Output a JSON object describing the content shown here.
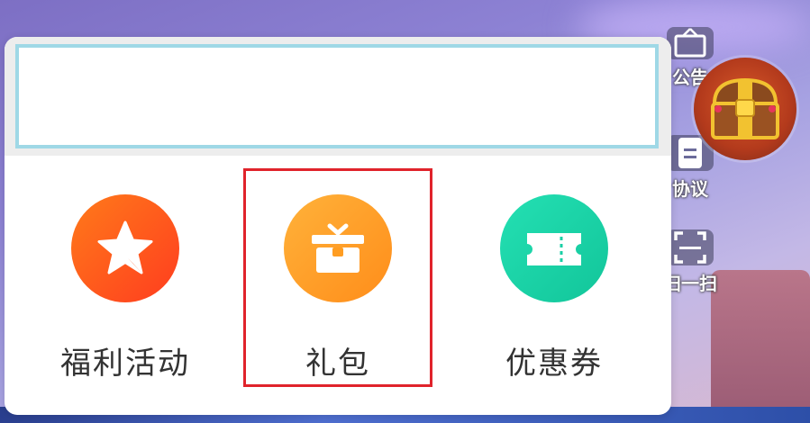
{
  "background": {
    "colors": {
      "top": "#7d6fc4",
      "bottom": "#d9b9cf"
    }
  },
  "game_toolbar": {
    "items": [
      {
        "label": "公告",
        "icon": "notice-board-icon"
      },
      {
        "label": "协议",
        "icon": "document-icon"
      },
      {
        "label": "扫一扫",
        "icon": "scan-icon"
      }
    ],
    "chest_icon": "treasure-chest-icon"
  },
  "popup": {
    "banner": {
      "border_color": "#9fd8e6",
      "text": ""
    },
    "items": [
      {
        "label": "福利活动",
        "icon": "star-icon",
        "color_from": "#ff7a1a",
        "color_to": "#ff3d1f"
      },
      {
        "label": "礼包",
        "icon": "gift-icon",
        "color_from": "#ffb23a",
        "color_to": "#ff8d1a",
        "selected": true
      },
      {
        "label": "优惠券",
        "icon": "ticket-icon",
        "color_from": "#24e0b3",
        "color_to": "#12c59a"
      }
    ],
    "highlight_color": "#e0232b"
  }
}
